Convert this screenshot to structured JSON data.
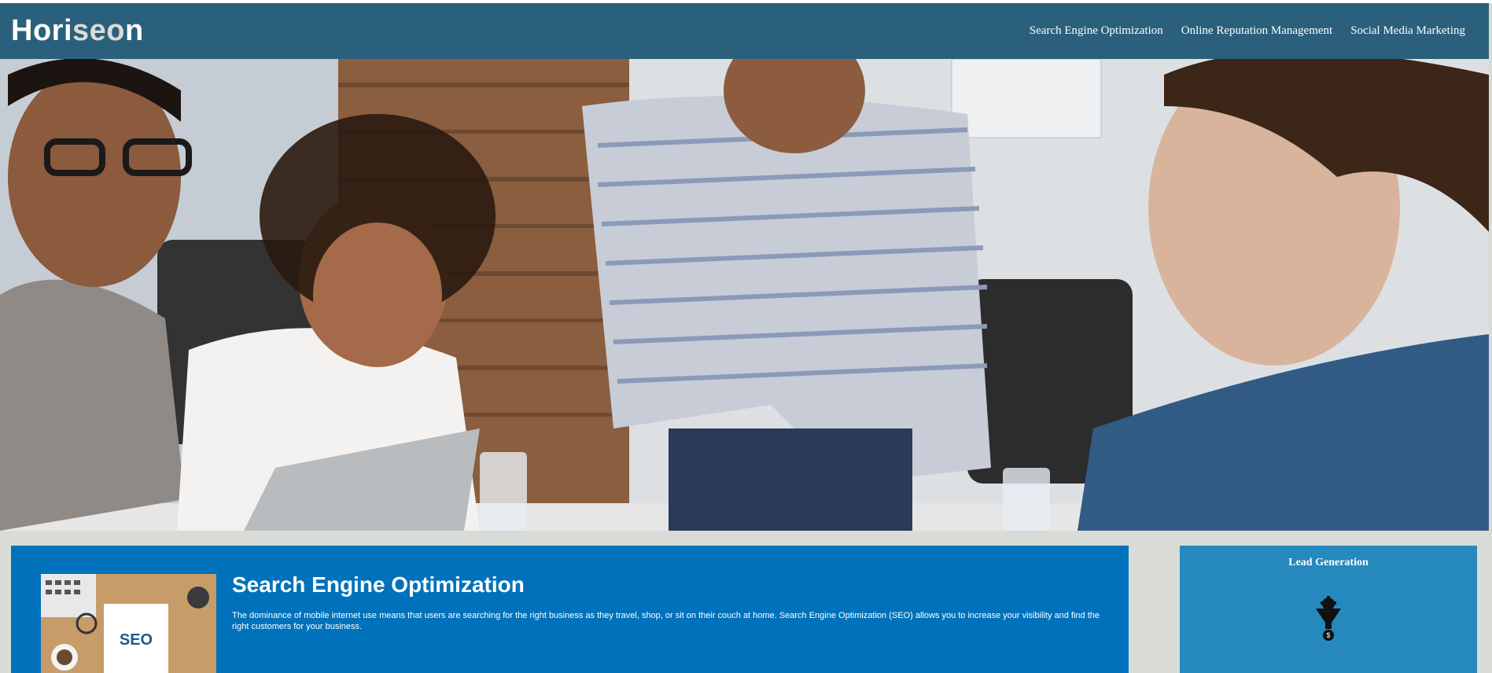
{
  "header": {
    "logo_main": "Hori",
    "logo_accent": "seo",
    "logo_tail": "n",
    "nav": [
      {
        "label": "Search Engine Optimization"
      },
      {
        "label": "Online Reputation Management"
      },
      {
        "label": "Social Media Marketing"
      }
    ]
  },
  "hero": {
    "image_name": "team-meeting-photo"
  },
  "content": {
    "title": "Search Engine Optimization",
    "text": "The dominance of mobile internet use means that users are searching for the right business as they travel, shop, or sit on their couch at home. Search Engine Optimization (SEO) allows you to increase your visibility and find the right customers for your business.",
    "figure_label": "SEO"
  },
  "benefits": {
    "title": "Lead Generation",
    "icon": "lead-funnel-icon"
  },
  "colors": {
    "header": "#2a607c",
    "content": "#0072bb",
    "benefits": "#2589bd",
    "page": "#d9dcd6",
    "logo_accent": "#d9dcd6"
  }
}
